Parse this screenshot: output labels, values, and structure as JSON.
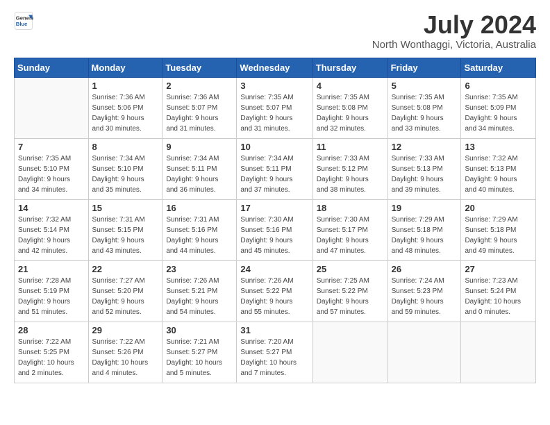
{
  "header": {
    "logo_line1": "General",
    "logo_line2": "Blue",
    "month": "July 2024",
    "location": "North Wonthaggi, Victoria, Australia"
  },
  "days_of_week": [
    "Sunday",
    "Monday",
    "Tuesday",
    "Wednesday",
    "Thursday",
    "Friday",
    "Saturday"
  ],
  "weeks": [
    [
      {
        "num": "",
        "info": ""
      },
      {
        "num": "1",
        "info": "Sunrise: 7:36 AM\nSunset: 5:06 PM\nDaylight: 9 hours\nand 30 minutes."
      },
      {
        "num": "2",
        "info": "Sunrise: 7:36 AM\nSunset: 5:07 PM\nDaylight: 9 hours\nand 31 minutes."
      },
      {
        "num": "3",
        "info": "Sunrise: 7:35 AM\nSunset: 5:07 PM\nDaylight: 9 hours\nand 31 minutes."
      },
      {
        "num": "4",
        "info": "Sunrise: 7:35 AM\nSunset: 5:08 PM\nDaylight: 9 hours\nand 32 minutes."
      },
      {
        "num": "5",
        "info": "Sunrise: 7:35 AM\nSunset: 5:08 PM\nDaylight: 9 hours\nand 33 minutes."
      },
      {
        "num": "6",
        "info": "Sunrise: 7:35 AM\nSunset: 5:09 PM\nDaylight: 9 hours\nand 34 minutes."
      }
    ],
    [
      {
        "num": "7",
        "info": "Sunrise: 7:35 AM\nSunset: 5:10 PM\nDaylight: 9 hours\nand 34 minutes."
      },
      {
        "num": "8",
        "info": "Sunrise: 7:34 AM\nSunset: 5:10 PM\nDaylight: 9 hours\nand 35 minutes."
      },
      {
        "num": "9",
        "info": "Sunrise: 7:34 AM\nSunset: 5:11 PM\nDaylight: 9 hours\nand 36 minutes."
      },
      {
        "num": "10",
        "info": "Sunrise: 7:34 AM\nSunset: 5:11 PM\nDaylight: 9 hours\nand 37 minutes."
      },
      {
        "num": "11",
        "info": "Sunrise: 7:33 AM\nSunset: 5:12 PM\nDaylight: 9 hours\nand 38 minutes."
      },
      {
        "num": "12",
        "info": "Sunrise: 7:33 AM\nSunset: 5:13 PM\nDaylight: 9 hours\nand 39 minutes."
      },
      {
        "num": "13",
        "info": "Sunrise: 7:32 AM\nSunset: 5:13 PM\nDaylight: 9 hours\nand 40 minutes."
      }
    ],
    [
      {
        "num": "14",
        "info": "Sunrise: 7:32 AM\nSunset: 5:14 PM\nDaylight: 9 hours\nand 42 minutes."
      },
      {
        "num": "15",
        "info": "Sunrise: 7:31 AM\nSunset: 5:15 PM\nDaylight: 9 hours\nand 43 minutes."
      },
      {
        "num": "16",
        "info": "Sunrise: 7:31 AM\nSunset: 5:16 PM\nDaylight: 9 hours\nand 44 minutes."
      },
      {
        "num": "17",
        "info": "Sunrise: 7:30 AM\nSunset: 5:16 PM\nDaylight: 9 hours\nand 45 minutes."
      },
      {
        "num": "18",
        "info": "Sunrise: 7:30 AM\nSunset: 5:17 PM\nDaylight: 9 hours\nand 47 minutes."
      },
      {
        "num": "19",
        "info": "Sunrise: 7:29 AM\nSunset: 5:18 PM\nDaylight: 9 hours\nand 48 minutes."
      },
      {
        "num": "20",
        "info": "Sunrise: 7:29 AM\nSunset: 5:18 PM\nDaylight: 9 hours\nand 49 minutes."
      }
    ],
    [
      {
        "num": "21",
        "info": "Sunrise: 7:28 AM\nSunset: 5:19 PM\nDaylight: 9 hours\nand 51 minutes."
      },
      {
        "num": "22",
        "info": "Sunrise: 7:27 AM\nSunset: 5:20 PM\nDaylight: 9 hours\nand 52 minutes."
      },
      {
        "num": "23",
        "info": "Sunrise: 7:26 AM\nSunset: 5:21 PM\nDaylight: 9 hours\nand 54 minutes."
      },
      {
        "num": "24",
        "info": "Sunrise: 7:26 AM\nSunset: 5:22 PM\nDaylight: 9 hours\nand 55 minutes."
      },
      {
        "num": "25",
        "info": "Sunrise: 7:25 AM\nSunset: 5:22 PM\nDaylight: 9 hours\nand 57 minutes."
      },
      {
        "num": "26",
        "info": "Sunrise: 7:24 AM\nSunset: 5:23 PM\nDaylight: 9 hours\nand 59 minutes."
      },
      {
        "num": "27",
        "info": "Sunrise: 7:23 AM\nSunset: 5:24 PM\nDaylight: 10 hours\nand 0 minutes."
      }
    ],
    [
      {
        "num": "28",
        "info": "Sunrise: 7:22 AM\nSunset: 5:25 PM\nDaylight: 10 hours\nand 2 minutes."
      },
      {
        "num": "29",
        "info": "Sunrise: 7:22 AM\nSunset: 5:26 PM\nDaylight: 10 hours\nand 4 minutes."
      },
      {
        "num": "30",
        "info": "Sunrise: 7:21 AM\nSunset: 5:27 PM\nDaylight: 10 hours\nand 5 minutes."
      },
      {
        "num": "31",
        "info": "Sunrise: 7:20 AM\nSunset: 5:27 PM\nDaylight: 10 hours\nand 7 minutes."
      },
      {
        "num": "",
        "info": ""
      },
      {
        "num": "",
        "info": ""
      },
      {
        "num": "",
        "info": ""
      }
    ]
  ]
}
